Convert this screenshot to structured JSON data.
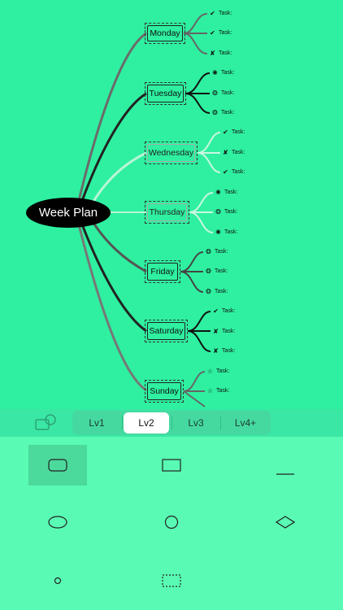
{
  "mindmap": {
    "root": "Week Plan",
    "days": [
      {
        "label": "Monday",
        "tasks": [
          {
            "mark": "✔",
            "text": "Task:"
          },
          {
            "mark": "✔",
            "text": "Task:"
          },
          {
            "mark": "✘",
            "text": "Task:"
          }
        ]
      },
      {
        "label": "Tuesday",
        "tasks": [
          {
            "mark": "✺",
            "text": "Task:"
          },
          {
            "mark": "❂",
            "text": "Task:"
          },
          {
            "mark": "❂",
            "text": "Task:"
          }
        ]
      },
      {
        "label": "Wednesday",
        "tasks": [
          {
            "mark": "✔",
            "text": "Task:"
          },
          {
            "mark": "✘",
            "text": "Task:"
          },
          {
            "mark": "✔",
            "text": "Task:"
          }
        ]
      },
      {
        "label": "Thursday",
        "tasks": [
          {
            "mark": "✺",
            "text": "Task:"
          },
          {
            "mark": "❂",
            "text": "Task:"
          },
          {
            "mark": "✺",
            "text": "Task:"
          }
        ]
      },
      {
        "label": "Friday",
        "tasks": [
          {
            "mark": "❂",
            "text": "Task:"
          },
          {
            "mark": "❂",
            "text": "Task:"
          },
          {
            "mark": "❂",
            "text": "Task:"
          }
        ]
      },
      {
        "label": "Saturday",
        "tasks": [
          {
            "mark": "✔",
            "text": "Task:"
          },
          {
            "mark": "✘",
            "text": "Task:"
          },
          {
            "mark": "✘",
            "text": "Task:"
          }
        ]
      },
      {
        "label": "Sunday",
        "tasks": [
          {
            "mark": "☆",
            "text": "Task:"
          },
          {
            "mark": "☆",
            "text": "Task:"
          }
        ]
      }
    ]
  },
  "toolbar": {
    "levels": [
      "Lv1",
      "Lv2",
      "Lv3",
      "Lv4+"
    ],
    "selected_level": "Lv2"
  },
  "shapes": [
    "rounded-rectangle",
    "rectangle",
    "underline",
    "ellipse",
    "circle",
    "diamond",
    "small-circle",
    "dashed-rectangle"
  ],
  "colors": {
    "background": "#2ef0a0",
    "panel": "#59fbb4",
    "root": "#000000"
  }
}
